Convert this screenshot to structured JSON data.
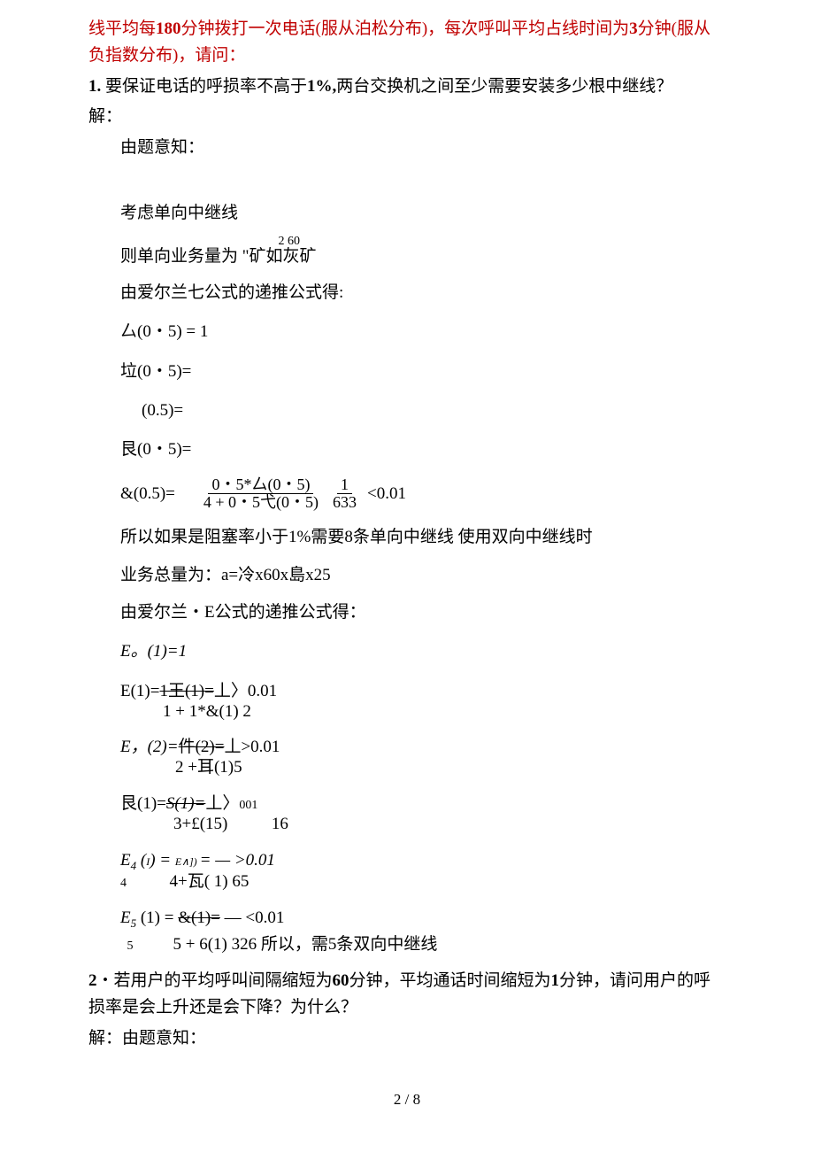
{
  "p1_red": "线平均每",
  "p1_b1": "180",
  "p1_red2": "分钟拨打一次电话(服从泊松分布)，每次呼叫平均占线时间为",
  "p1_b2": "3",
  "p1_red3": "分钟(服从负指数分布)，请问：",
  "q1_num": "1.",
  "q1_text_a": " 要保证电话的呼损率不高于",
  "q1_b1": "1%,",
  "q1_text_b": "两台交换机之间至少需要安装多少根中继线？",
  "ans_label": "解：",
  "l1": "由题意知：",
  "l2": "考虑单向中继线",
  "l3_over": "2 60",
  "l3": "则单向业务量为 \"矿如灰矿",
  "l4": "由爱尔兰七公式的递推公式得:",
  "l5": "厶(0・5) = 1",
  "l6": "垃(0・5)=",
  "l7": "(0.5)=",
  "l8": "艮(0・5)=",
  "l9_lhs": "&(0.5)=",
  "l9_num1": "0・5*厶(0・5)",
  "l9_den1": "4 + 0・5弋(0・5)",
  "l9_num2": "1",
  "l9_den2": "633",
  "l9_tail": "<0.01",
  "l10": "所以如果是阻塞率小于1%需要8条单向中继线  使用双向中继线时",
  "l11": "业务总量为：a=冷x60x島x25",
  "l12": "由爱尔兰・E公式的递推公式得：",
  "l13_a": "E",
  "l13_b": "。",
  "l13_c": "(1)=1",
  "l14a": "E(1)=",
  "l14_strike": "1王(1)=",
  "l14b": "丄〉0.01",
  "l14c": "1 + 1*&(1) 2",
  "l15a": "E，(2)=",
  "l15_strike": "件(2)=",
  "l15b": "丄>0.01",
  "l15c": "2 +耳(1)5",
  "l16a": "艮(1)=",
  "l16_strike": "S(1)=",
  "l16b": "丄〉",
  "l16c": "001",
  "l16d": "3+£(15)",
  "l16e": "16",
  "l17a": "E",
  "l17sub": "4",
  "l17b": " (",
  "l17i": "I",
  "l17c": ") = ",
  "l17sup": "E∧]) ",
  "l17d": "= — >0.01",
  "l17e": "4",
  "l17f": "4+瓦( 1) 65",
  "l18a": "E",
  "l18sub": "5",
  "l18b": " (1) = ",
  "l18_strike": "&(1)=",
  "l18c": " — <0.01",
  "l18d": "5",
  "l18e": "5 + 6(1) 326 所以，需5条双向中继线",
  "q2_num": "2",
  "q2_text_a": "・若用户的平均呼叫间隔缩短为",
  "q2_b1": "60",
  "q2_text_b": "分钟，平均通话时间缩短为",
  "q2_b2": "1",
  "q2_text_c": "分钟，请问用户的呼损率是会上升还是会下降？为什么？",
  "ans2": "解：由题意知：",
  "pagenum": "2 / 8"
}
